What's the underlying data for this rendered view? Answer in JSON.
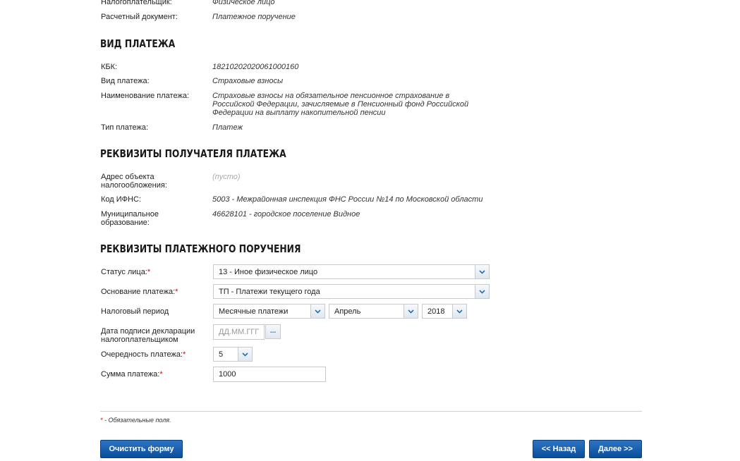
{
  "top_rows": [
    {
      "label": "Налогоплательщик:",
      "value": "Физическое лицо"
    },
    {
      "label": "Расчетный документ:",
      "value": "Платежное поручение"
    }
  ],
  "section_payment_type": {
    "title": "ВИД ПЛАТЕЖА",
    "kbk_label": "КБК:",
    "kbk_value": "18210202020061000160",
    "type_label": "Вид платежа:",
    "type_value": "Страховые взносы",
    "name_label": "Наименование платежа:",
    "name_value": "Страховые взносы на обязательное пенсионное страхование в Российской Федерации, зачисляемые в Пенсионный фонд Российской Федерации на выплату накопительной пенсии",
    "kind_label": "Тип платежа:",
    "kind_value": "Платеж"
  },
  "section_recipient": {
    "title": "РЕКВИЗИТЫ ПОЛУЧАТЕЛЯ ПЛАТЕЖА",
    "address_label": "Адрес объекта налогообложения:",
    "address_value": "(пусто)",
    "ifns_label": "Код ИФНС:",
    "ifns_value": "5003 - Межрайонная инспекция ФНС России №14 по Московской области",
    "mun_label": "Муниципальное образование:",
    "mun_value": "46628101 - городское поселение Видное"
  },
  "section_order": {
    "title": "РЕКВИЗИТЫ ПЛАТЕЖНОГО ПОРУЧЕНИЯ",
    "status_label": "Статус лица:",
    "status_value": "13 - Иное физическое лицо",
    "basis_label": "Основание платежа:",
    "basis_value": "ТП - Платежи текущего года",
    "period_label": "Налоговый период",
    "period_type_value": "Месячные платежи",
    "period_month_value": "Апрель",
    "period_year_value": "2018",
    "decl_date_label": "Дата подписи декларации налогоплательщиком",
    "decl_date_placeholder": "ДД.ММ.ГГГ",
    "decl_date_button": "...",
    "priority_label": "Очередность платежа:",
    "priority_value": "5",
    "amount_label": "Сумма платежа:",
    "amount_value": "1000",
    "required_mark": "*"
  },
  "footer": {
    "required_note_mark": "*",
    "required_note_text": " - Обязательные поля.",
    "clear_button": "Очистить форму",
    "back_button": "<< Назад",
    "next_button": "Далее >>"
  },
  "colors": {
    "accent_blue": "#0a4f9c",
    "required_red": "#dd0000"
  }
}
